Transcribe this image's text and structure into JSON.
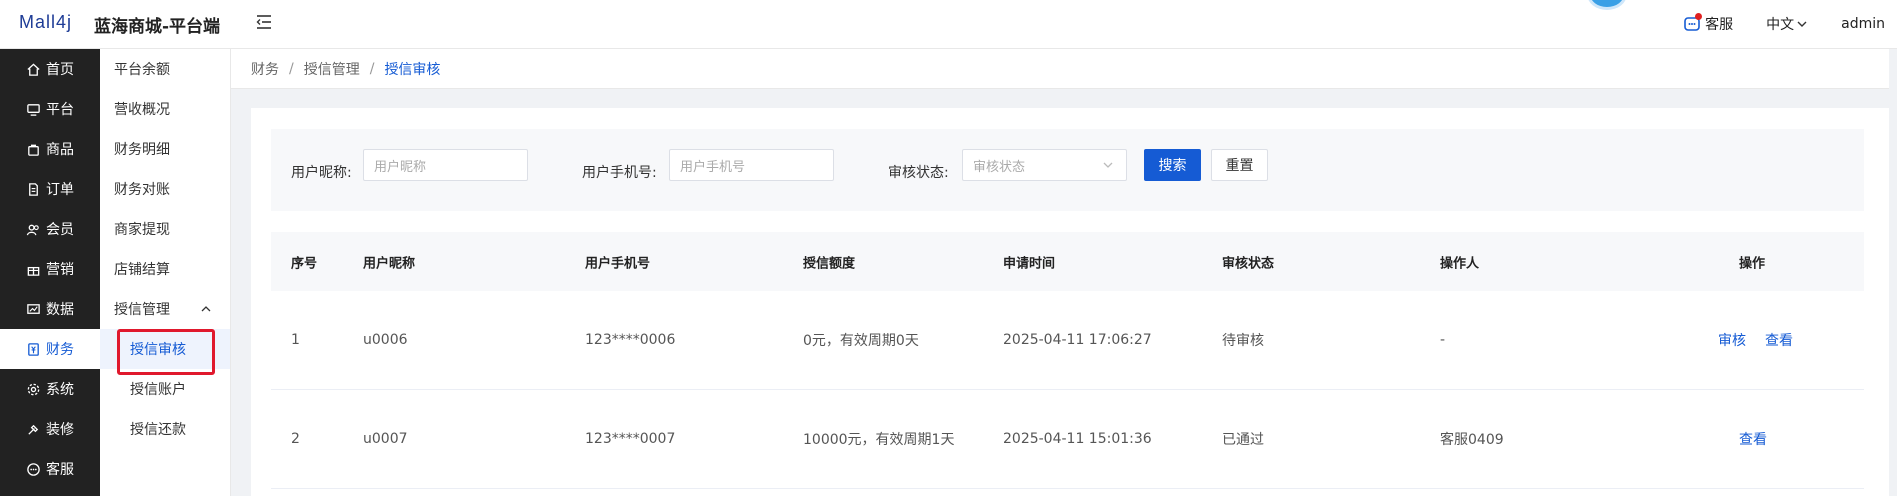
{
  "header": {
    "logo_text": "Mall4j",
    "site_title": "蓝海商城-平台端",
    "customer_service": "客服",
    "language": "中文",
    "user": "admin"
  },
  "sidebar": {
    "items": [
      {
        "label": "首页",
        "icon": "home-icon"
      },
      {
        "label": "平台",
        "icon": "monitor-icon"
      },
      {
        "label": "商品",
        "icon": "bag-icon"
      },
      {
        "label": "订单",
        "icon": "document-icon"
      },
      {
        "label": "会员",
        "icon": "users-icon"
      },
      {
        "label": "营销",
        "icon": "gift-icon"
      },
      {
        "label": "数据",
        "icon": "chart-icon"
      },
      {
        "label": "财务",
        "icon": "finance-icon",
        "active": true
      },
      {
        "label": "系统",
        "icon": "gear-icon"
      },
      {
        "label": "装修",
        "icon": "brush-icon"
      },
      {
        "label": "客服",
        "icon": "chat-icon"
      }
    ]
  },
  "submenu": {
    "items": [
      {
        "label": "平台余额"
      },
      {
        "label": "营收概况"
      },
      {
        "label": "财务明细"
      },
      {
        "label": "财务对账"
      },
      {
        "label": "商家提现"
      },
      {
        "label": "店铺结算"
      },
      {
        "label": "授信管理",
        "group": true
      },
      {
        "label": "授信审核",
        "child": true,
        "active": true
      },
      {
        "label": "授信账户",
        "child": true
      },
      {
        "label": "授信还款",
        "child": true
      }
    ]
  },
  "breadcrumb": [
    "财务",
    "授信管理",
    "授信审核"
  ],
  "search": {
    "nickname_label": "用户昵称:",
    "nickname_placeholder": "用户昵称",
    "phone_label": "用户手机号:",
    "phone_placeholder": "用户手机号",
    "status_label": "审核状态:",
    "status_placeholder": "审核状态",
    "search_button": "搜索",
    "reset_button": "重置"
  },
  "table": {
    "columns": [
      "序号",
      "用户昵称",
      "用户手机号",
      "授信额度",
      "申请时间",
      "审核状态",
      "操作人",
      "操作"
    ],
    "rows": [
      {
        "index": "1",
        "nickname": "u0006",
        "phone": "123****0006",
        "credit": "0元，有效周期0天",
        "time": "2025-04-11 17:06:27",
        "status": "待审核",
        "operator": "-",
        "actions": [
          "审核",
          "查看"
        ]
      },
      {
        "index": "2",
        "nickname": "u0007",
        "phone": "123****0007",
        "credit": "10000元，有效周期1天",
        "time": "2025-04-11 15:01:36",
        "status": "已通过",
        "operator": "客服0409",
        "actions": [
          "查看"
        ]
      }
    ]
  },
  "colors": {
    "primary": "#155bd4",
    "sidebar_bg": "#222222",
    "highlight_box": "#e0182d"
  }
}
